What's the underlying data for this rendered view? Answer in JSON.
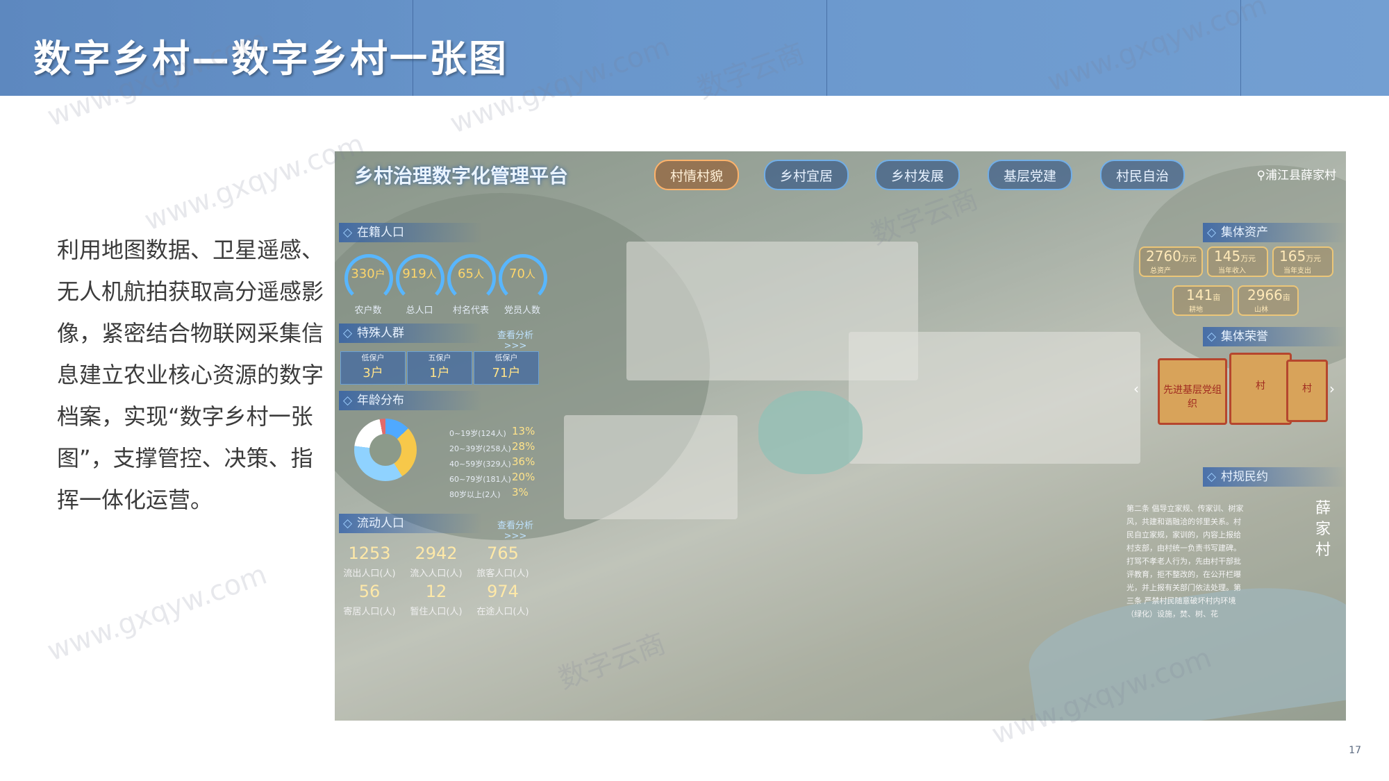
{
  "slide": {
    "title": "数字乡村—数字乡村一张图",
    "body": "利用地图数据、卫星遥感、无人机航拍获取高分遥感影像，紧密结合物联网采集信息建立农业核心资源的数字档案，实现“数字乡村一张图”，支撑管控、决策、指挥一体化运营。",
    "page_number": "17",
    "watermark_cn": "数字云商",
    "watermark_url": "www.gxqyw.com",
    "colors": {
      "header": "#6a97cc",
      "text": "#3b3b3b"
    }
  },
  "platform": {
    "title": "乡村治理数字化管理平台",
    "nav": [
      "村情村貌",
      "乡村宜居",
      "乡村发展",
      "基层党建",
      "村民自治"
    ],
    "active_nav": "村情村貌",
    "location": "浦江县薛家村",
    "location_icon": "map-pin-icon"
  },
  "registered_population": {
    "title": "在籍人口",
    "items": [
      {
        "value": "330",
        "unit": "户",
        "label": "农户数"
      },
      {
        "value": "919",
        "unit": "人",
        "label": "总人口"
      },
      {
        "value": "65",
        "unit": "人",
        "label": "村名代表"
      },
      {
        "value": "70",
        "unit": "人",
        "label": "党员人数"
      }
    ]
  },
  "special_groups": {
    "title": "特殊人群",
    "link": "查看分析 >>>",
    "items": [
      {
        "label": "低保户",
        "value": "3户"
      },
      {
        "label": "五保户",
        "value": "1户"
      },
      {
        "label": "低保户",
        "value": "71户"
      }
    ]
  },
  "age_distribution": {
    "title": "年龄分布",
    "legend": [
      {
        "label": "0~19岁(124人)",
        "pct": "13%"
      },
      {
        "label": "20~39岁(258人)",
        "pct": "28%"
      },
      {
        "label": "40~59岁(329人)",
        "pct": "36%"
      },
      {
        "label": "60~79岁(181人)",
        "pct": "20%"
      },
      {
        "label": "80岁以上(2人)",
        "pct": "3%"
      }
    ]
  },
  "floating_population": {
    "title": "流动人口",
    "link": "查看分析 >>>",
    "items": [
      {
        "value": "1253",
        "label": "流出人口(人)"
      },
      {
        "value": "2942",
        "label": "流入人口(人)"
      },
      {
        "value": "765",
        "label": "旅客人口(人)"
      },
      {
        "value": "56",
        "label": "寄居人口(人)"
      },
      {
        "value": "12",
        "label": "暂住人口(人)"
      },
      {
        "value": "974",
        "label": "在途人口(人)"
      }
    ]
  },
  "collective_assets": {
    "title": "集体资产",
    "items": [
      {
        "value": "2760",
        "unit": "万元",
        "label": "总资产"
      },
      {
        "value": "145",
        "unit": "万元",
        "label": "当年收入"
      },
      {
        "value": "165",
        "unit": "万元",
        "label": "当年支出"
      },
      {
        "value": "141",
        "unit": "亩",
        "label": "耕地"
      },
      {
        "value": "2966",
        "unit": "亩",
        "label": "山林"
      }
    ]
  },
  "collective_honors": {
    "title": "集体荣誉",
    "items": [
      "先进基层党组织",
      "村",
      "村"
    ]
  },
  "village_rules": {
    "title": "村规民约",
    "text": "第二条 倡导立家规、传家训、树家风，共建和谐融洽的邻里关系。村民自立家规，家训的，内容上报给村支部，由村统一负责书写建碑。打骂不孝老人行为，先由村干部批评教育，拒不整改的，在公开栏曝光，并上报有关部门依法处理。第三条 严禁村民随意破坏村内环境（绿化）设施，焚、树、花",
    "calligraphy": "薛家村"
  }
}
